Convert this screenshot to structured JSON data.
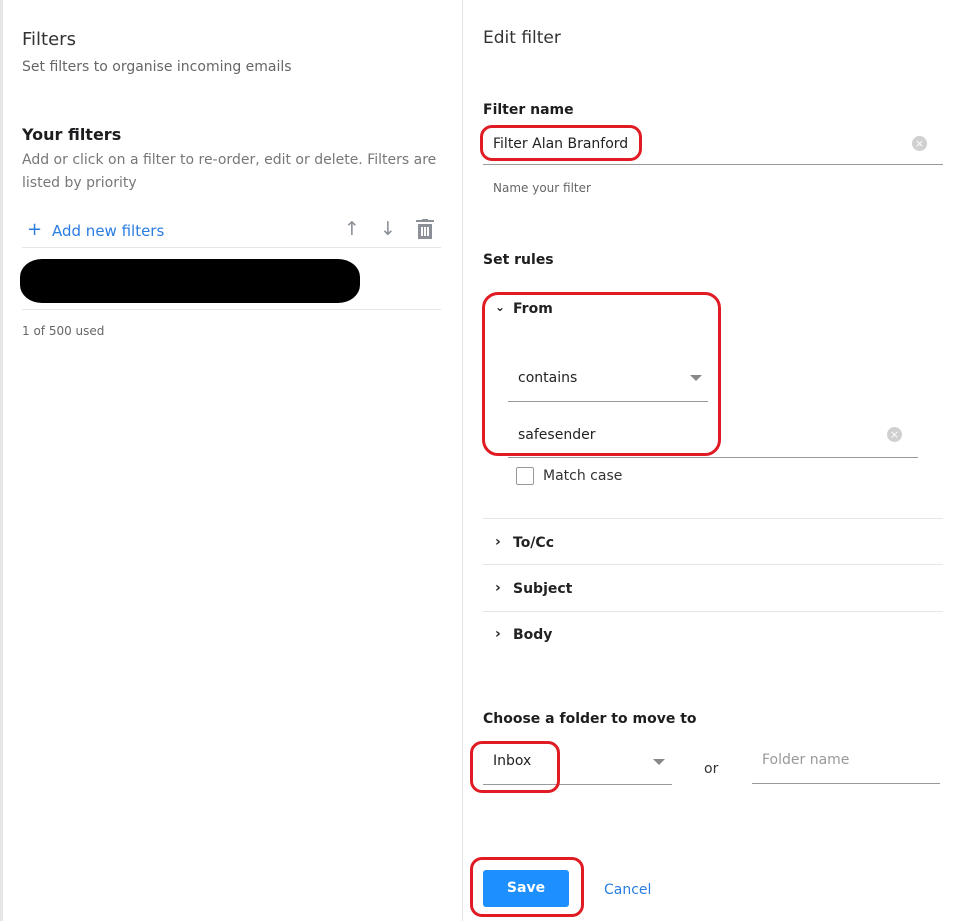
{
  "left": {
    "title": "Filters",
    "subtitle": "Set filters to organise incoming emails",
    "your_filters": "Your filters",
    "description": "Add or click on a filter to re-order, edit or delete. Filters are listed by priority",
    "add_label": "Add new filters",
    "usage": "1 of 500 used"
  },
  "edit": {
    "title": "Edit filter",
    "filter_name_label": "Filter name",
    "filter_name_value": "Filter Alan Branford",
    "filter_name_hint": "Name your filter",
    "set_rules": "Set rules",
    "rules": {
      "from": {
        "label": "From",
        "operator": "contains",
        "value": "safesender",
        "match_case": "Match case",
        "match_case_checked": false
      },
      "to_cc": "To/Cc",
      "subject": "Subject",
      "body": "Body"
    },
    "folder_label": "Choose a folder to move to",
    "folder_value": "Inbox",
    "or": "or",
    "folder_name_placeholder": "Folder name",
    "save": "Save",
    "cancel": "Cancel"
  },
  "colors": {
    "accent": "#1e8fff",
    "link": "#2a7de1",
    "annotation": "#e01b24"
  }
}
